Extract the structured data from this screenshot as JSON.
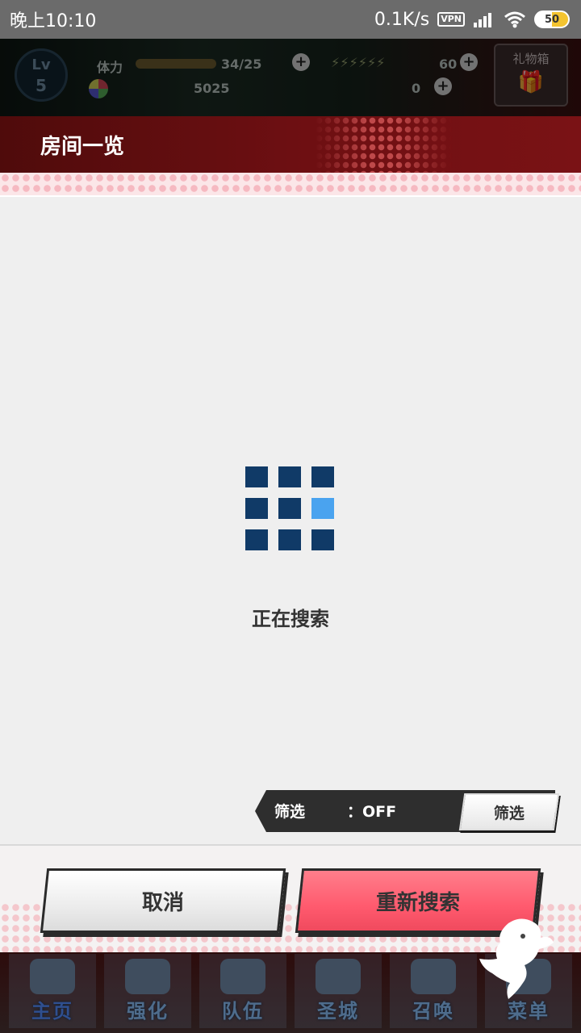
{
  "status_bar": {
    "time": "晚上10:10",
    "net_speed": "0.1K/s",
    "vpn": "VPN",
    "battery": "50"
  },
  "hud": {
    "level_label": "Lv",
    "level": "5",
    "stamina_label": "体力",
    "stamina_value": "34/25",
    "coins": "5025",
    "gem_count": "0",
    "energy_value": "60",
    "gift_box_label": "礼物箱"
  },
  "page": {
    "title": "房间一览"
  },
  "search": {
    "status_text": "正在搜索"
  },
  "filter": {
    "label": "筛选",
    "status": "：OFF",
    "button_label": "筛选"
  },
  "actions": {
    "cancel_label": "取消",
    "research_label": "重新搜索"
  },
  "nav": {
    "items": [
      {
        "label": "主页",
        "icon": "home-icon"
      },
      {
        "label": "强化",
        "icon": "upgrade-icon"
      },
      {
        "label": "队伍",
        "icon": "team-icon"
      },
      {
        "label": "圣城",
        "icon": "city-icon"
      },
      {
        "label": "召唤",
        "icon": "summon-icon"
      },
      {
        "label": "菜单",
        "icon": "menu-icon"
      }
    ]
  },
  "colors": {
    "title_bar": "#6d0f12",
    "loader_dark": "#103a67",
    "loader_active": "#4aa3ef",
    "research_button": "#ff5a6e"
  }
}
